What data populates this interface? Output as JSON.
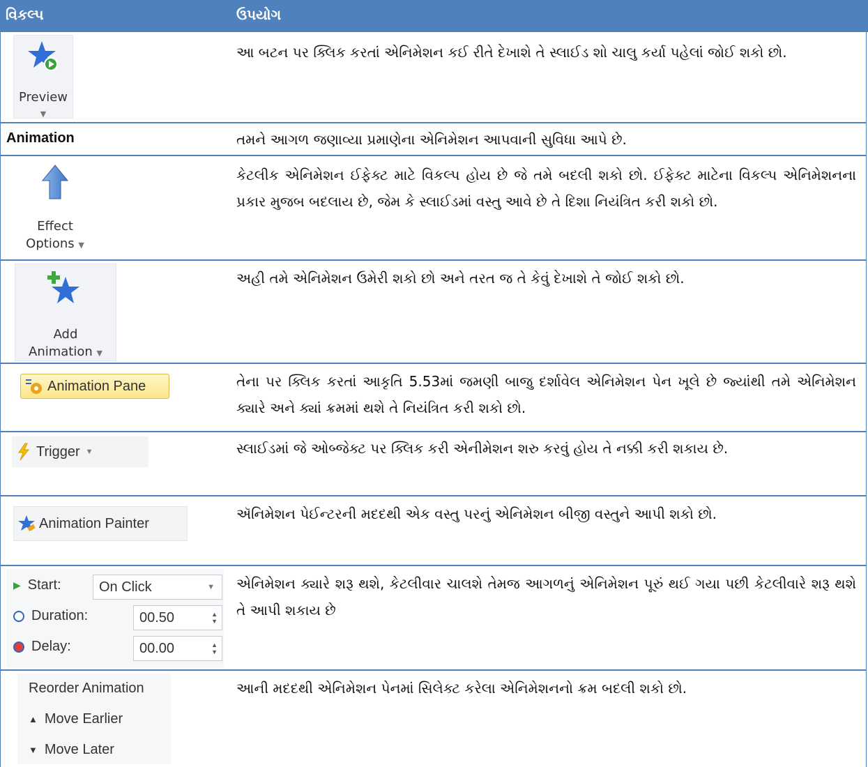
{
  "header": {
    "col_option": "વિકલ્પ",
    "col_use": "ઉપયોગ"
  },
  "rows": [
    {
      "option": {
        "name": "Preview",
        "icon": "preview-star-play-icon"
      },
      "desc": "આ બટન પર ક્લિક કરતાં એનિમેશન કઈ રીતે દેખાશે તે સ્લાઈડ શો ચાલુ કર્યા પહેલાં જોઈ શકો છો."
    },
    {
      "option": {
        "name": "Animation"
      },
      "desc": "તમને આગળ જણાવ્યા પ્રમાણેના એનિમેશન આપવાની સુવિધા આપે છે."
    },
    {
      "option": {
        "line1": "Effect",
        "line2": "Options",
        "icon": "up-arrow-icon"
      },
      "desc": "કેટલીક એનિમેશન ઈફેક્ટ માટે વિકલ્પ હોય છે જે તમે બદલી શકો છો. ઈફેક્ટ માટેના વિકલ્પ એનિમેશનના પ્રકાર મુજબ બદલાય છે, જેમ કે સ્લાઈડમાં વસ્તુ આવે છે તે દિશા નિયંત્રિત કરી શકો છો."
    },
    {
      "option": {
        "line1": "Add",
        "line2": "Animation",
        "icon": "add-star-icon"
      },
      "desc": "અહી તમે એનિમેશન ઉમેરી શકો છો અને તરત જ તે કેવું દેખાશે તે જોઈ શકો છો."
    },
    {
      "option": {
        "name": "Animation Pane",
        "icon": "animation-pane-icon"
      },
      "desc": "તેના પર ક્લિક કરતાં આકૃતિ 5.53માં જમણી બાજુ દર્શાવેલ એનિમેશન પેન ખૂલે છે જ્યાંથી તમે એનિમેશન ક્યારે અને ક્યાં ક્રમમાં થશે તે નિયંત્રિત કરી શકો છો."
    },
    {
      "option": {
        "name": "Trigger",
        "icon": "lightning-icon"
      },
      "desc": "સ્લાઈડમાં જે ઓબ્જેક્ટ પર ક્લિક કરી એનીમેશન શરુ કરવું હોય તે નક્કી કરી શકાય છે."
    },
    {
      "option": {
        "name": "Animation Painter",
        "icon": "painter-star-icon"
      },
      "desc": "ઍનિમેશન પેઈન્ટરની મદદથી એક વસ્તુ પરનું એનિમેશન બીજી વસ્તુને આપી શકો છો."
    },
    {
      "option": {
        "start_label": "Start:",
        "start_value": "On Click",
        "duration_label": "Duration:",
        "duration_value": "00.50",
        "delay_label": "Delay:",
        "delay_value": "00.00"
      },
      "desc": "એનિમેશન ક્યારે શરૂ થશે, કેટલીવાર ચાલશે તેમજ આગળનું એનિમેશન પૂરું થઈ ગયા પછી કેટલીવારે શરૂ  થશે તે આપી શકાય છે"
    },
    {
      "option": {
        "title": "Reorder Animation",
        "earlier": "Move Earlier",
        "later": "Move Later"
      },
      "desc": "આની મદદથી એનિમેશન પેનમાં સિલેક્ટ કરેલા એનિમેશનનો ક્રમ બદલી શકો છો."
    }
  ],
  "colors": {
    "header_bg": "#4f81bd",
    "border": "#4f81bd",
    "star": "#2f6fd6",
    "play": "#3aa23a",
    "plus": "#3fa83f"
  }
}
